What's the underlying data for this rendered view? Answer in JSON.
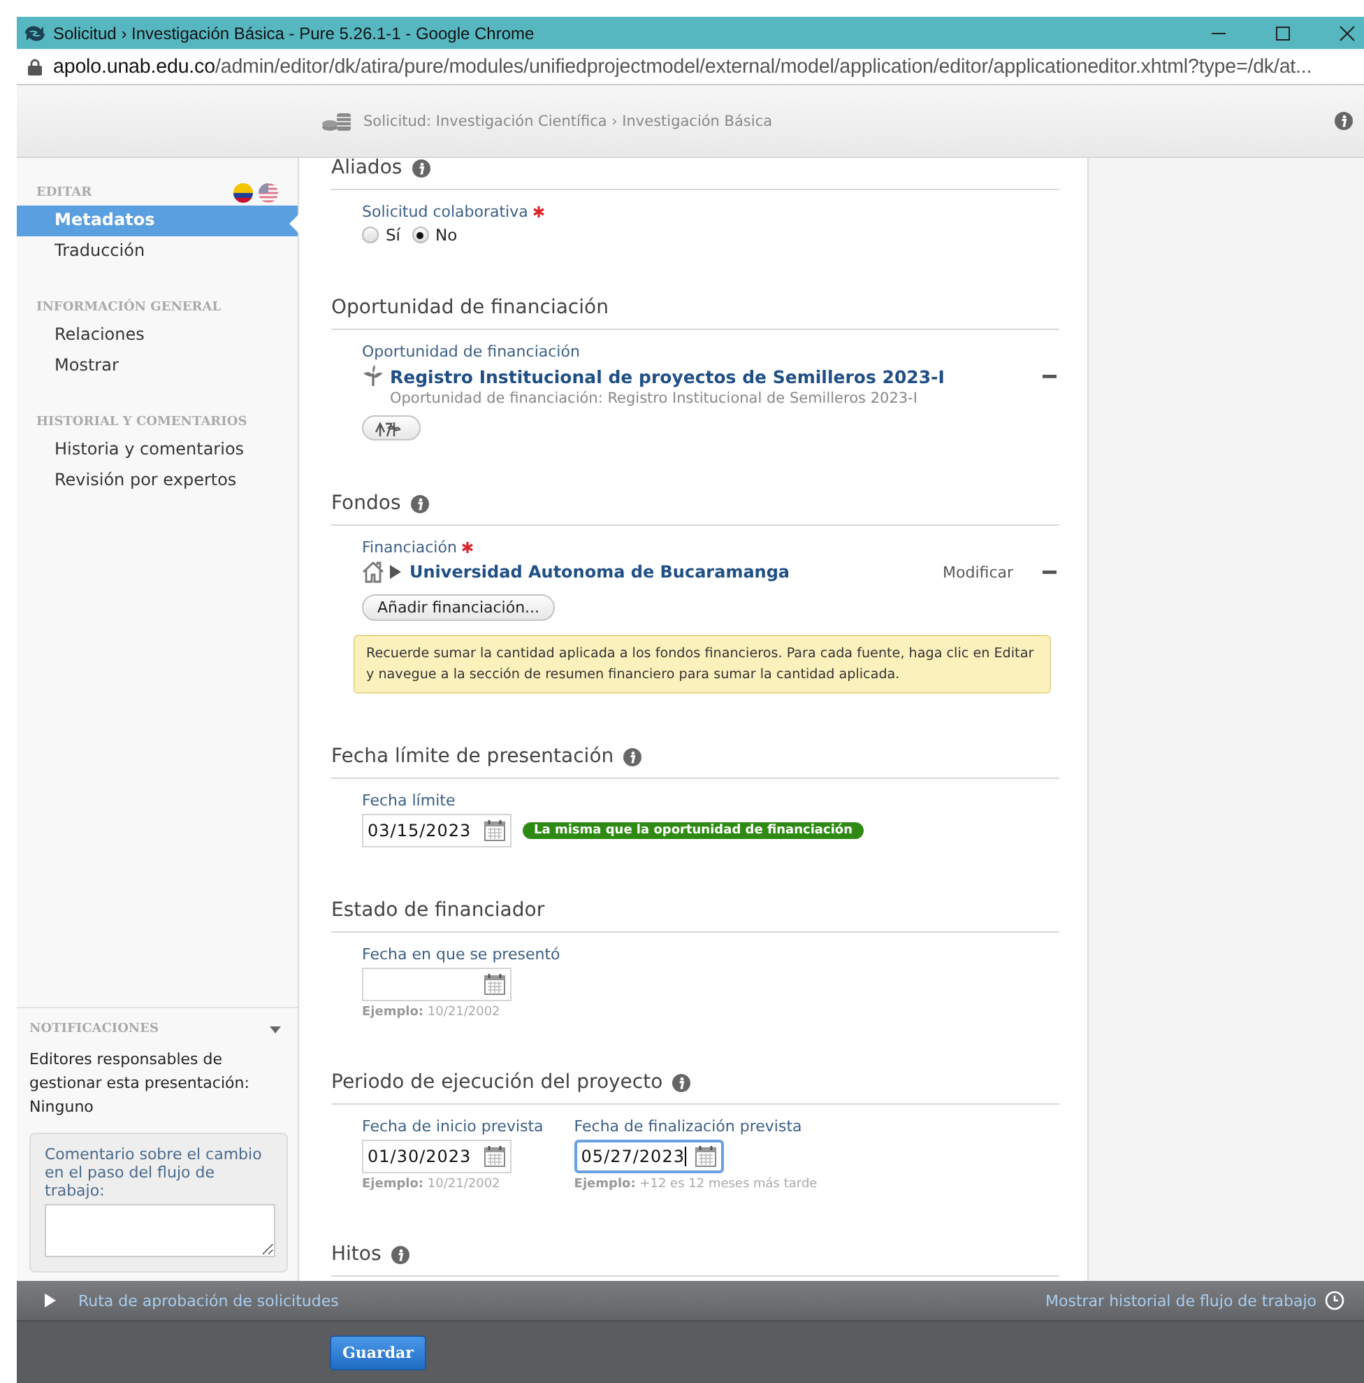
{
  "window": {
    "title": "Solicitud › Investigación Básica - Pure 5.26.1-1 - Google Chrome",
    "url_host": "apolo.unab.edu.co",
    "url_path": "/admin/editor/dk/atira/pure/modules/unifiedprojectmodel/external/model/application/editor/applicationeditor.xhtml?type=/dk/at..."
  },
  "header": {
    "breadcrumb": "Solicitud: Investigación Científica › Investigación Básica"
  },
  "sidebar": {
    "sections": [
      {
        "heading": "EDITAR",
        "flags": true,
        "items": [
          {
            "label": "Metadatos",
            "selected": true
          },
          {
            "label": "Traducción",
            "selected": false
          }
        ]
      },
      {
        "heading": "INFORMACIÓN GENERAL",
        "items": [
          {
            "label": "Relaciones",
            "selected": false
          },
          {
            "label": "Mostrar",
            "selected": false
          }
        ]
      },
      {
        "heading": "HISTORIAL Y COMENTARIOS",
        "items": [
          {
            "label": "Historia y comentarios",
            "selected": false
          },
          {
            "label": "Revisión por expertos",
            "selected": false
          }
        ]
      }
    ],
    "notifications": {
      "heading": "NOTIFICACIONES",
      "text": "Editores responsables de gestionar esta presentación: Ninguno",
      "comment_label": "Comentario sobre el cambio en el paso del flujo de trabajo:"
    }
  },
  "sections": [
    {
      "title": "Aliados",
      "info": true,
      "fields": [
        {
          "kind": "radio",
          "label": "Solicitud colaborativa",
          "required": true,
          "options": [
            {
              "label": "Sí",
              "selected": false
            },
            {
              "label": "No",
              "selected": true
            }
          ]
        }
      ]
    },
    {
      "title": "Oportunidad de financiación",
      "info": false,
      "fields": [
        {
          "kind": "opportunity",
          "label": "Oportunidad de financiación",
          "link": "Registro Institucional de proyectos de Semilleros 2023-I",
          "detail": "Oportunidad de financiación: Registro Institucional de Semilleros 2023-I"
        }
      ]
    },
    {
      "title": "Fondos",
      "info": true,
      "fields": [
        {
          "kind": "funding",
          "label": "Financiación",
          "required": true,
          "link": "Universidad Autonoma de Bucaramanga",
          "action": "Modificar",
          "button": "Añadir financiación..."
        },
        {
          "kind": "notice",
          "text": "Recuerde sumar la cantidad aplicada a los fondos financieros. Para cada fuente, haga clic en Editar y navegue a la sección de resumen financiero para sumar la cantidad aplicada."
        }
      ]
    },
    {
      "title": "Fecha límite de presentación",
      "info": true,
      "fields": [
        {
          "kind": "date",
          "label": "Fecha límite",
          "value": "03/15/2023",
          "badge": "La misma que la oportunidad de financiación",
          "focused": false
        }
      ]
    },
    {
      "title": "Estado de financiador",
      "info": false,
      "fields": [
        {
          "kind": "date",
          "label": "Fecha en que se presentó",
          "example": "**Ejemplo:** 10/21/2002",
          "focused": false
        }
      ]
    },
    {
      "title": "Periodo de ejecución del proyecto",
      "info": true,
      "fields": [
        {
          "kind": "date",
          "label": "Fecha de inicio prevista",
          "value": "01/30/2023",
          "example": "**Ejemplo:** 10/21/2002",
          "focused": false
        },
        {
          "kind": "date",
          "label": "Fecha de finalización prevista",
          "value": "05/27/2023",
          "example": "**Ejemplo:** +12 es 12 meses más tarde",
          "focused": true
        }
      ]
    },
    {
      "title": "Hitos",
      "info": true
    }
  ],
  "footer": {
    "route": "Ruta de aprobación de solicitudes",
    "history": "Mostrar historial de flujo de trabajo",
    "save": "Guardar"
  }
}
